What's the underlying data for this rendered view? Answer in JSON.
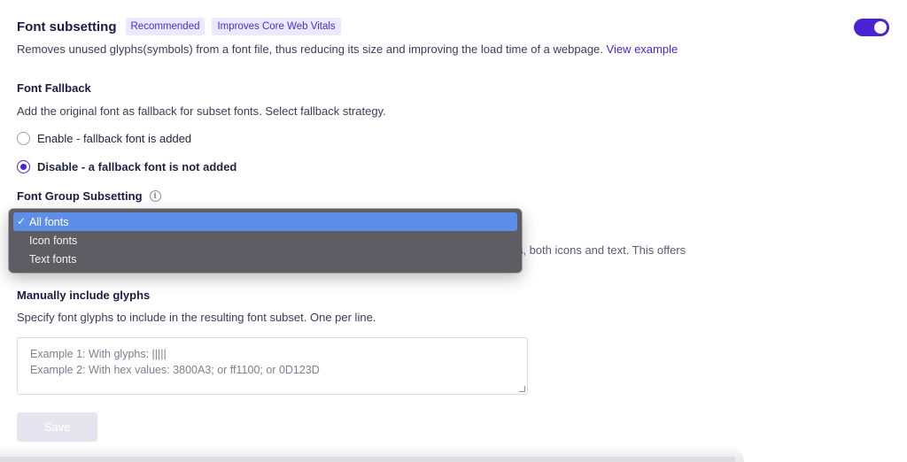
{
  "header": {
    "title": "Font subsetting",
    "badges": [
      "Recommended",
      "Improves Core Web Vitals"
    ],
    "toggle_on": true
  },
  "description": {
    "text": "Removes unused glyphs(symbols) from a font file, thus reducing its size and improving the load time of a webpage. ",
    "link": "View example"
  },
  "fallback": {
    "title": "Font Fallback",
    "description": "Add the original font as fallback for subset fonts. Select fallback strategy.",
    "options": [
      {
        "label": "Enable - fallback font is added",
        "selected": false
      },
      {
        "label": "Disable - a fallback font is not added",
        "selected": true
      }
    ]
  },
  "group": {
    "title": "Font Group Subsetting",
    "info_icon": "info-icon",
    "behind_text": "t files, both icons and text. This offers",
    "dropdown": {
      "options": [
        "All fonts",
        "Icon fonts",
        "Text fonts"
      ],
      "selected": "All fonts",
      "check_glyph": "✓"
    }
  },
  "glyphs": {
    "title": "Manually include glyphs",
    "description": "Specify font glyphs to include in the resulting font subset. One per line.",
    "placeholder_lines": [
      "Example 1: With glyphs: |||||",
      "Example 2: With hex values: 3800A3; or ff1100; or 0D123D"
    ]
  },
  "actions": {
    "save_label": "Save"
  },
  "colors": {
    "accent": "#4a23d4",
    "badge_bg": "#ece8ff",
    "dropdown_bg": "#5e5d63",
    "dropdown_active": "#5d8fe8"
  }
}
